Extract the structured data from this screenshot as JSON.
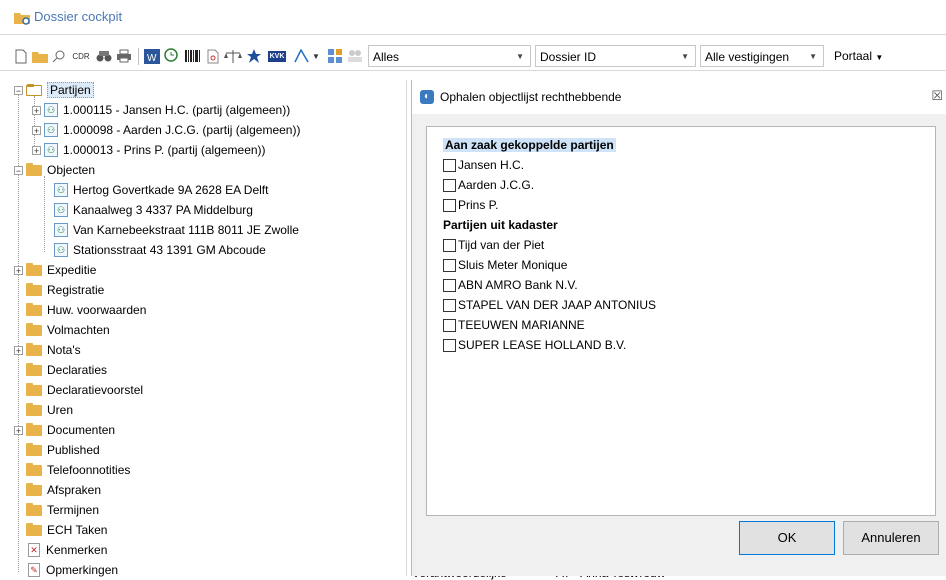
{
  "window": {
    "title": "Dossier cockpit"
  },
  "toolbar": {
    "combo_filter": "Alles",
    "combo_field": "Dossier ID",
    "combo_location": "Alle vestigingen",
    "portal_label": "Portaal",
    "cdr_label": "CDR",
    "kvk_label": "KVK"
  },
  "tree": {
    "partijen": "Partijen",
    "partijen_items": [
      "1.000115 - Jansen H.C. (partij (algemeen))",
      "1.000098 - Aarden J.C.G. (partij (algemeen))",
      "1.000013 - Prins P. (partij (algemeen))"
    ],
    "objecten": "Objecten",
    "objecten_items": [
      "Hertog Govertkade 9A 2628 EA Delft",
      "Kanaalweg 3 4337 PA Middelburg",
      "Van Karnebeekstraat 111B 8011 JE Zwolle",
      "Stationsstraat 43 1391 GM Abcoude"
    ],
    "folders": [
      "Expeditie",
      "Registratie",
      "Huw. voorwaarden",
      "Volmachten",
      "Nota's",
      "Declaraties",
      "Declaratievoorstel",
      "Uren",
      "Documenten",
      "Published",
      "Telefoonnotities",
      "Afspraken",
      "Termijnen",
      "ECH Taken"
    ],
    "kenmerken": "Kenmerken",
    "opmerkingen": "Opmerkingen"
  },
  "dialog": {
    "title": "Ophalen objectlijst rechthebbende",
    "section1": "Aan zaak gekoppelde partijen",
    "section1_items": [
      "Jansen H.C.",
      "Aarden J.C.G.",
      "Prins P."
    ],
    "section2": "Partijen uit kadaster",
    "section2_items": [
      "Tijd van der Piet",
      "Sluis Meter Monique",
      "ABN AMRO Bank N.V.",
      "STAPEL VAN DER JAAP ANTONIUS",
      "TEEUWEN MARIANNE",
      "SUPER LEASE HOLLAND B.V."
    ],
    "ok": "OK",
    "cancel": "Annuleren"
  },
  "background": {
    "label": "Verantwoordelijke",
    "value": "AT - Anna Testvrouw"
  }
}
